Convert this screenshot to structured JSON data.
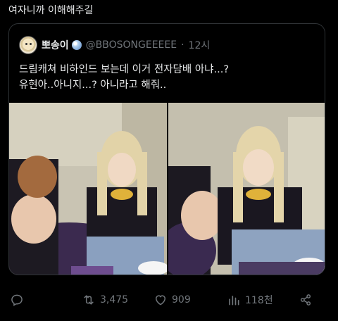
{
  "post": {
    "text": "여자니까 이해해주길"
  },
  "quoted": {
    "display_name": "뽀송이",
    "handle": "@BBOSONGEEEEE",
    "separator": "·",
    "time": "12시",
    "text_line1": "드림캐쳐 비하인드 보는데 이거 전자담배 아냐...?",
    "text_line2": "유현아..아니지...? 아니라고 해줘.."
  },
  "actions": {
    "reply_icon": "reply-icon",
    "retweet_count": "3,475",
    "like_count": "909",
    "views_count": "118천",
    "share_icon": "share-icon"
  },
  "colors": {
    "background": "#000000",
    "text": "#e7e9ea",
    "muted": "#71767b",
    "border": "#2f3336"
  }
}
